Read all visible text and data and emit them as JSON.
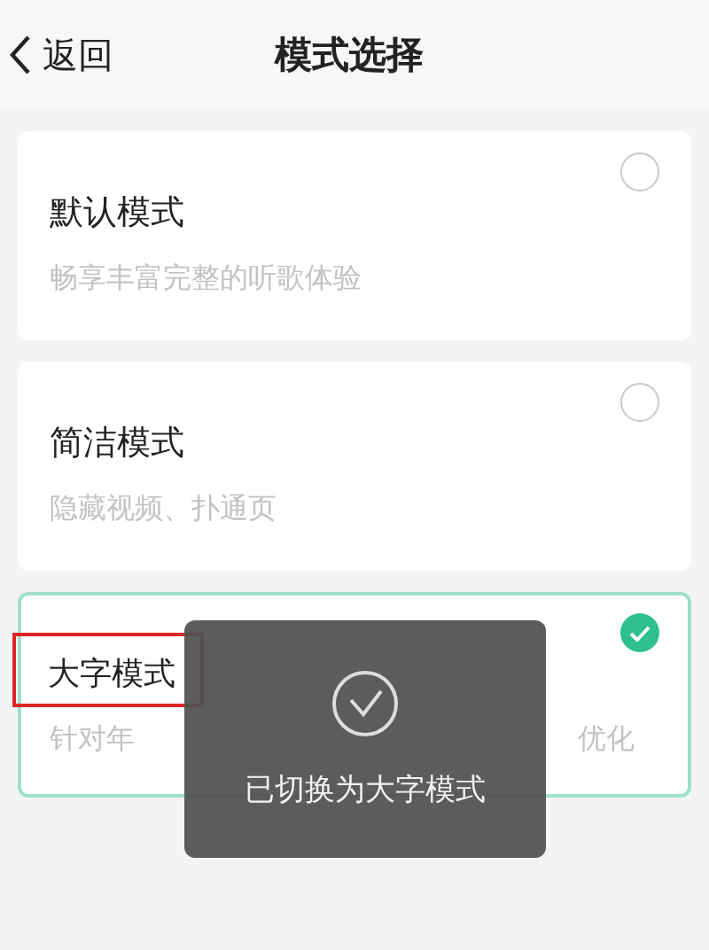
{
  "header": {
    "back_label": "返回",
    "title": "模式选择"
  },
  "modes": [
    {
      "name": "默认模式",
      "description": "畅享丰富完整的听歌体验",
      "selected": false,
      "highlighted": false
    },
    {
      "name": "简洁模式",
      "description": "隐藏视频、扑通页",
      "selected": false,
      "highlighted": false
    },
    {
      "name": "大字模式",
      "description_fragments": [
        "针对年",
        "优化"
      ],
      "selected": true,
      "highlighted": true
    }
  ],
  "toast": {
    "message": "已切换为大字模式"
  }
}
